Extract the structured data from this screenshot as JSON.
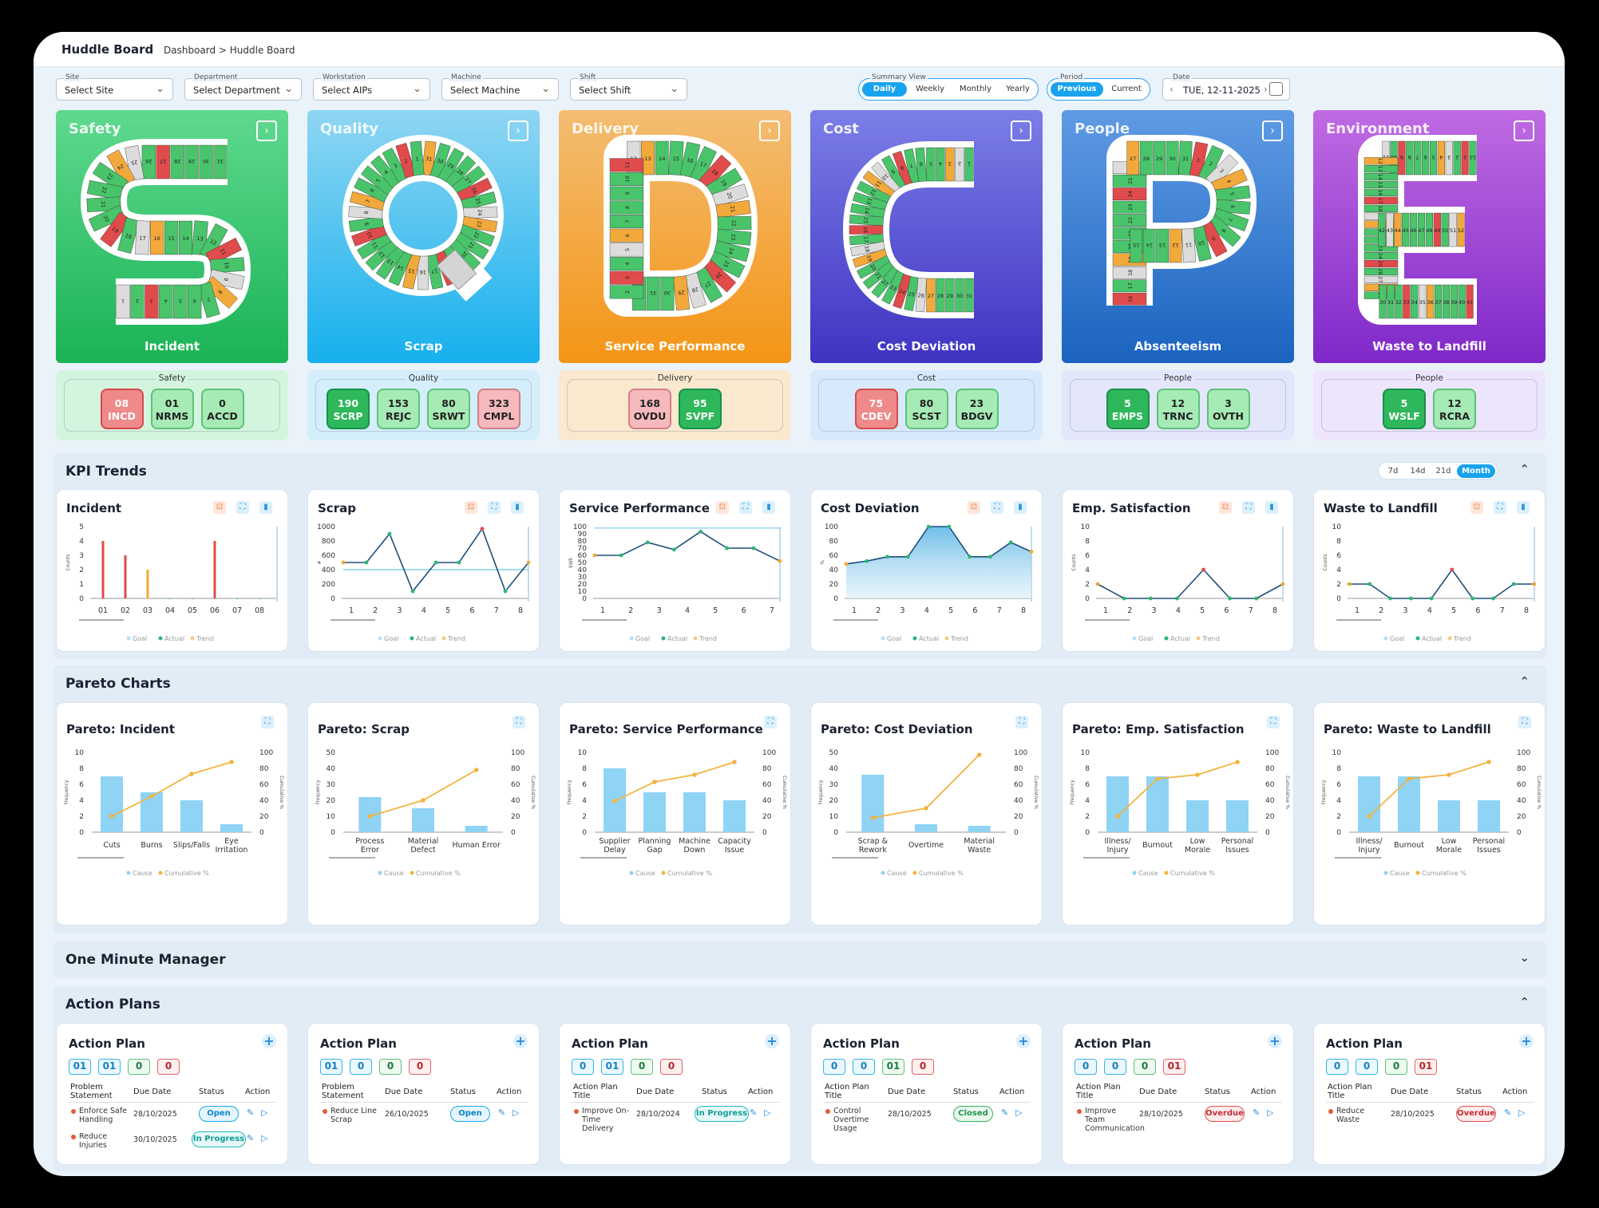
{
  "header": {
    "title": "Huddle Board",
    "breadcrumb": "Dashboard > Huddle Board"
  },
  "filters": [
    {
      "label": "Site",
      "value": "Select Site"
    },
    {
      "label": "Department",
      "value": "Select Department"
    },
    {
      "label": "Workstation",
      "value": "Select AIPs"
    },
    {
      "label": "Machine",
      "value": "Select Machine"
    },
    {
      "label": "Shift",
      "value": "Select Shift"
    }
  ],
  "summary_view": {
    "label": "Summary View",
    "options": [
      "Daily",
      "Weekly",
      "Monthly",
      "Yearly"
    ],
    "selected": "Daily"
  },
  "period": {
    "label": "Period",
    "options": [
      "Previous",
      "Current"
    ],
    "selected": "Previous"
  },
  "date": {
    "label": "Date",
    "value": "TUE, 12-11-2025"
  },
  "sqcpde": [
    {
      "title": "Safety",
      "letter": "S",
      "subtitle": "Incident",
      "grad": [
        "#5fd98e",
        "#1bb356"
      ]
    },
    {
      "title": "Quality",
      "letter": "Q",
      "subtitle": "Scrap",
      "grad": [
        "#8fd6f2",
        "#16b0ee"
      ]
    },
    {
      "title": "Delivery",
      "letter": "D",
      "subtitle": "Service Performance",
      "grad": [
        "#f3bd72",
        "#f49516"
      ]
    },
    {
      "title": "Cost",
      "letter": "C",
      "subtitle": "Cost Deviation",
      "grad": [
        "#7b7ee7",
        "#3f33c2"
      ]
    },
    {
      "title": "People",
      "letter": "P",
      "subtitle": "Absenteeism",
      "grad": [
        "#5f9be4",
        "#1b63c0"
      ]
    },
    {
      "title": "Environment",
      "letter": "E",
      "subtitle": "Waste to Landfill",
      "grad": [
        "#c06be3",
        "#7e28c9"
      ]
    }
  ],
  "kpi_groups": [
    {
      "title": "Safety",
      "bg": "#d3f5de",
      "items": [
        {
          "v": "08",
          "k": "INCD",
          "s": "red"
        },
        {
          "v": "01",
          "k": "NRMS",
          "s": "lg"
        },
        {
          "v": "0",
          "k": "ACCD",
          "s": "lg"
        }
      ]
    },
    {
      "title": "Quality",
      "bg": "#d4eefb",
      "items": [
        {
          "v": "190",
          "k": "SCRP",
          "s": "dg"
        },
        {
          "v": "153",
          "k": "REJC",
          "s": "lg"
        },
        {
          "v": "80",
          "k": "SRWT",
          "s": "lg"
        },
        {
          "v": "323",
          "k": "CMPL",
          "s": "pink"
        }
      ]
    },
    {
      "title": "Delivery",
      "bg": "#fae8cf",
      "items": [
        {
          "v": "168",
          "k": "OVDU",
          "s": "pink"
        },
        {
          "v": "95",
          "k": "SVPF",
          "s": "dg"
        }
      ]
    },
    {
      "title": "Cost",
      "bg": "#d6eafb",
      "items": [
        {
          "v": "75",
          "k": "CDEV",
          "s": "red"
        },
        {
          "v": "80",
          "k": "SCST",
          "s": "lg"
        },
        {
          "v": "23",
          "k": "BDGV",
          "s": "lg"
        }
      ]
    },
    {
      "title": "People",
      "bg": "#e4e6fb",
      "items": [
        {
          "v": "5",
          "k": "EMPS",
          "s": "dg"
        },
        {
          "v": "12",
          "k": "TRNC",
          "s": "lg"
        },
        {
          "v": "3",
          "k": "OVTH",
          "s": "lg"
        }
      ]
    },
    {
      "title": "People",
      "bg": "#ece5fb",
      "items": [
        {
          "v": "5",
          "k": "WSLF",
          "s": "dg"
        },
        {
          "v": "12",
          "k": "RCRA",
          "s": "lg"
        }
      ]
    }
  ],
  "kpi_trends": {
    "title": "KPI Trends",
    "ranges": [
      "7d",
      "14d",
      "21d",
      "Month"
    ],
    "selected": "Month",
    "legend": [
      "Goal",
      "Actual",
      "Trend"
    ]
  },
  "pareto_title": "Pareto Charts",
  "omm_title": "One Minute Manager",
  "ap_title": "Action Plans",
  "chart_data": [
    {
      "type": "bar",
      "title": "Incident",
      "ylabel": "Counts",
      "categories": [
        "01",
        "02",
        "03",
        "04",
        "05",
        "06",
        "07",
        "08"
      ],
      "values": [
        4,
        3,
        2,
        0,
        0,
        4,
        0,
        0
      ],
      "colors": [
        "#e04b4b",
        "#e04b4b",
        "#f2a93b",
        "#4cc1e8",
        "#4cc1e8",
        "#e04b4b",
        "#4cc1e8",
        "#4cc1e8"
      ],
      "ylim": [
        0,
        5
      ],
      "yticks": [
        0,
        1,
        2,
        3,
        4,
        5
      ],
      "goal": null
    },
    {
      "type": "line",
      "title": "Scrap",
      "ylabel": "#",
      "x": [
        "1",
        "2",
        "3",
        "4",
        "5",
        "6",
        "7",
        "8"
      ],
      "values": [
        500,
        500,
        900,
        100,
        500,
        500,
        970,
        100,
        500
      ],
      "ylim": [
        0,
        1000
      ],
      "yticks": [
        0,
        200,
        400,
        600,
        800,
        1000
      ],
      "goal": 400,
      "area": false
    },
    {
      "type": "line",
      "title": "Service Performance",
      "ylabel": "kWh",
      "x": [
        "1",
        "2",
        "3",
        "4",
        "5",
        "6",
        "7"
      ],
      "values": [
        60,
        60,
        78,
        68,
        93,
        70,
        70,
        52
      ],
      "ylim": [
        0,
        100
      ],
      "yticks": [
        0,
        10,
        20,
        30,
        40,
        50,
        60,
        70,
        80,
        90,
        100
      ],
      "goal": 98,
      "area": false
    },
    {
      "type": "line",
      "title": "Cost Deviation",
      "ylabel": "%",
      "x": [
        "1",
        "2",
        "3",
        "4",
        "5",
        "6",
        "7",
        "8"
      ],
      "values": [
        48,
        52,
        58,
        58,
        100,
        100,
        58,
        58,
        78,
        65
      ],
      "ylim": [
        0,
        100
      ],
      "yticks": [
        0,
        20,
        40,
        60,
        80,
        100
      ],
      "goal": null,
      "area": true
    },
    {
      "type": "line",
      "title": "Emp. Satisfaction",
      "ylabel": "Counts",
      "x": [
        "1",
        "2",
        "3",
        "4",
        "5",
        "6",
        "7",
        "8"
      ],
      "values": [
        2,
        0,
        0,
        0,
        4,
        0,
        0,
        2
      ],
      "ylim": [
        0,
        10
      ],
      "yticks": [
        0,
        2,
        4,
        6,
        8,
        10
      ],
      "goal": null,
      "area": false
    },
    {
      "type": "line",
      "title": "Waste to Landfill",
      "ylabel": "Counts",
      "x": [
        "1",
        "2",
        "3",
        "4",
        "5",
        "6",
        "7",
        "8"
      ],
      "values": [
        2,
        2,
        0,
        0,
        0,
        4,
        0,
        0,
        2,
        2
      ],
      "ylim": [
        0,
        10
      ],
      "yticks": [
        0,
        2,
        4,
        6,
        8,
        10
      ],
      "goal": null,
      "area": false
    },
    {
      "type": "bar",
      "title": "Pareto: Incident",
      "categories": [
        "Cuts",
        "Burns",
        "Slips/Falls",
        "Eye Irritation"
      ],
      "values": [
        7,
        5,
        4,
        1
      ],
      "cumulative": [
        20,
        45,
        73,
        88
      ],
      "ylim": [
        0,
        10
      ],
      "yticks": [
        0,
        2,
        4,
        6,
        8,
        10
      ],
      "ylabel": "Frequency",
      "y2label": "Cumulative %",
      "legend": [
        "Cause",
        "Cumulative %"
      ]
    },
    {
      "type": "bar",
      "title": "Pareto: Scrap",
      "categories": [
        "Process Error",
        "Material Defect",
        "Human Error"
      ],
      "values": [
        22,
        15,
        4
      ],
      "cumulative": [
        20,
        40,
        78
      ],
      "ylim": [
        0,
        50
      ],
      "yticks": [
        0,
        10,
        20,
        30,
        40,
        50
      ],
      "ylabel": "Frequency",
      "y2label": "Cumulative %",
      "legend": [
        "Cause",
        "Cumulative %"
      ]
    },
    {
      "type": "bar",
      "title": "Pareto: Service Performance",
      "categories": [
        "Supplier Delay",
        "Planning Gap",
        "Machine Down",
        "Capacity Issue"
      ],
      "values": [
        8,
        5,
        5,
        4
      ],
      "cumulative": [
        39,
        63,
        72,
        88
      ],
      "ylim": [
        0,
        10
      ],
      "yticks": [
        0,
        2,
        4,
        6,
        8,
        10
      ],
      "ylabel": "Frequency",
      "y2label": "Cumulative %",
      "legend": [
        "Cause",
        "Cumulative %"
      ]
    },
    {
      "type": "bar",
      "title": "Pareto: Cost Deviation",
      "categories": [
        "Scrap & Rework",
        "Overtime",
        "Material Waste"
      ],
      "values": [
        36,
        5,
        4
      ],
      "cumulative": [
        18,
        30,
        97
      ],
      "ylim": [
        0,
        50
      ],
      "yticks": [
        0,
        10,
        20,
        30,
        40,
        50
      ],
      "ylabel": "Frequency",
      "y2label": "Cumulative %",
      "legend": [
        "Cause",
        "Cumulative %"
      ]
    },
    {
      "type": "bar",
      "title": "Pareto: Emp. Satisfaction",
      "categories": [
        "Illness/ Injury",
        "Burnout",
        "Low Morale",
        "Personal Issues"
      ],
      "values": [
        7,
        7,
        4,
        4
      ],
      "cumulative": [
        20,
        67,
        72,
        88
      ],
      "ylim": [
        0,
        10
      ],
      "yticks": [
        0,
        2,
        4,
        6,
        8,
        10
      ],
      "ylabel": "Frequency",
      "y2label": "Cumulative %",
      "legend": [
        "Cause",
        "Cumulative %"
      ]
    },
    {
      "type": "bar",
      "title": "Pareto: Waste to Landfill",
      "categories": [
        "Illness/ Injury",
        "Burnout",
        "Low Morale",
        "Personal Issues"
      ],
      "values": [
        7,
        7,
        4,
        4
      ],
      "cumulative": [
        20,
        67,
        72,
        88
      ],
      "ylim": [
        0,
        10
      ],
      "yticks": [
        0,
        2,
        4,
        6,
        8,
        10
      ],
      "ylabel": "Frequency",
      "y2label": "Cumulative %",
      "legend": [
        "Cause",
        "Cumulative %"
      ]
    }
  ],
  "action_plans": [
    {
      "title": "Action Plan",
      "badges": [
        "01",
        "01",
        "0",
        "0"
      ],
      "col1": "Problem Statement",
      "rows": [
        {
          "t": "Enforce Safe Handling",
          "d": "28/10/2025",
          "s": "Open"
        },
        {
          "t": "Reduce Injuries",
          "d": "30/10/2025",
          "s": "In Progress"
        }
      ]
    },
    {
      "title": "Action Plan",
      "badges": [
        "01",
        "0",
        "0",
        "0"
      ],
      "col1": "Problem Statement",
      "rows": [
        {
          "t": "Reduce Line Scrap",
          "d": "26/10/2025",
          "s": "Open"
        }
      ]
    },
    {
      "title": "Action Plan",
      "badges": [
        "0",
        "01",
        "0",
        "0"
      ],
      "col1": "Action Plan Title",
      "rows": [
        {
          "t": "Improve On-Time Delivery",
          "d": "28/10/2024",
          "s": "In Progress"
        }
      ]
    },
    {
      "title": "Action Plan",
      "badges": [
        "0",
        "0",
        "01",
        "0"
      ],
      "col1": "Action Plan Title",
      "rows": [
        {
          "t": "Control Overtime Usage",
          "d": "28/10/2025",
          "s": "Closed"
        }
      ]
    },
    {
      "title": "Action Plan",
      "badges": [
        "0",
        "0",
        "0",
        "01"
      ],
      "col1": "Action Plan Title",
      "rows": [
        {
          "t": "Improve Team Communication",
          "d": "28/10/2025",
          "s": "Overdue"
        }
      ]
    },
    {
      "title": "Action Plan",
      "badges": [
        "0",
        "0",
        "0",
        "01"
      ],
      "col1": "Action Plan Title",
      "rows": [
        {
          "t": "Reduce Waste",
          "d": "28/10/2025",
          "s": "Overdue"
        }
      ]
    }
  ],
  "ap_headers": {
    "due": "Due Date",
    "status": "Status",
    "action": "Action"
  },
  "letter_tiles": {
    "S": [
      "31",
      "30",
      "29",
      "28",
      "27",
      "26",
      "25",
      "24",
      "23",
      "22",
      "21",
      "20",
      "19",
      "18",
      "17",
      "16",
      "15",
      "14",
      "13",
      "12",
      "11",
      "10",
      "9",
      "8",
      "7",
      "6",
      "5",
      "4",
      "3",
      "2",
      "1"
    ],
    "Q": [
      "31",
      "30",
      "29",
      "28",
      "27",
      "26",
      "25",
      "24",
      "23",
      "22",
      "21",
      "20",
      "19",
      "18",
      "17",
      "16",
      "15",
      "14",
      "13",
      "12",
      "11",
      "10",
      "9",
      "8",
      "7",
      "6",
      "5",
      "4",
      "3",
      "2",
      "1"
    ],
    "D": [
      "12",
      "13",
      "14",
      "15",
      "16",
      "17",
      "18",
      "19",
      "20",
      "21",
      "22",
      "23",
      "24",
      "25",
      "26",
      "27",
      "28",
      "29",
      "30",
      "31",
      "1",
      "2",
      "3",
      "4",
      "5",
      "6",
      "7",
      "8",
      "9",
      "10",
      "11"
    ],
    "C": [
      "1",
      "2",
      "3",
      "4",
      "5",
      "6",
      "7",
      "8",
      "9",
      "10",
      "11",
      "12",
      "13",
      "14",
      "15",
      "16",
      "17",
      "18",
      "19",
      "20",
      "21",
      "22",
      "23",
      "24",
      "25",
      "26",
      "27",
      "28",
      "29",
      "30",
      "31"
    ],
    "P": [
      "16",
      "17",
      "18",
      "19",
      "20",
      "21",
      "22",
      "23",
      "24",
      "25",
      "26",
      "27",
      "28",
      "29",
      "30",
      "31",
      "1",
      "2",
      "3",
      "4",
      "5",
      "6",
      "7",
      "8",
      "9",
      "10",
      "11",
      "12",
      "13",
      "14",
      "15"
    ],
    "E": [
      "53",
      "1",
      "2",
      "3",
      "4",
      "5",
      "6",
      "7",
      "8",
      "9",
      "10",
      "11",
      "12",
      "13",
      "14",
      "15",
      "16",
      "17",
      "18",
      "19",
      "20",
      "21",
      "22",
      "23",
      "24",
      "25",
      "26",
      "27",
      "28",
      "29",
      "30",
      "31",
      "32",
      "33",
      "34",
      "35",
      "36",
      "37",
      "38",
      "39",
      "40",
      "41",
      "42",
      "43",
      "44",
      "45",
      "46",
      "47",
      "48",
      "49",
      "50",
      "51",
      "52"
    ]
  }
}
